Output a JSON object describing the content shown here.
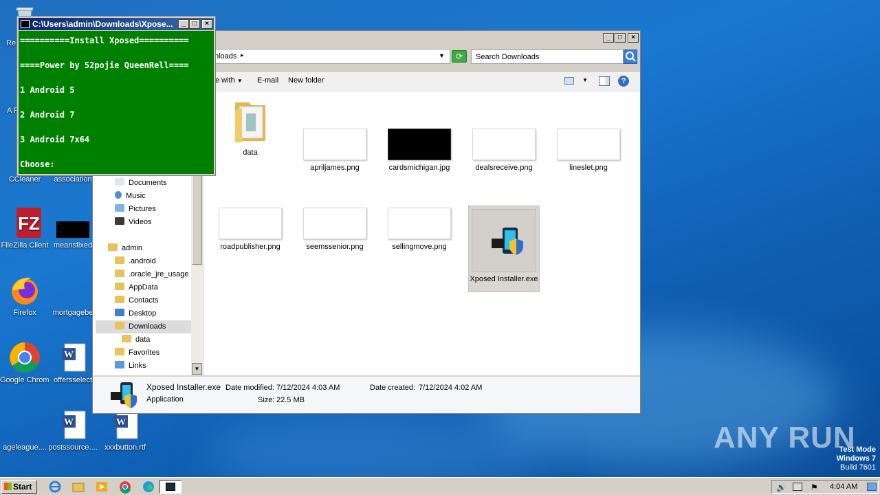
{
  "desktop_icons": [
    {
      "label": "Re",
      "icon": "recycle-bin-icon"
    },
    {
      "label": "A Re",
      "icon": "acrobat-icon"
    },
    {
      "label": "CCleaner",
      "icon": "ccleaner-icon"
    },
    {
      "label": "association",
      "icon": "file-icon"
    },
    {
      "label": "FileZilla Client",
      "icon": "filezilla-icon"
    },
    {
      "label": "meansfixed",
      "icon": "image-file-icon"
    },
    {
      "label": "Firefox",
      "icon": "firefox-icon"
    },
    {
      "label": "mortgagebe",
      "icon": "file-icon"
    },
    {
      "label": "Google Chrome",
      "icon": "chrome-icon"
    },
    {
      "label": "offersselect",
      "icon": "word-doc-icon"
    },
    {
      "label": "ageleague....",
      "icon": "file-icon"
    },
    {
      "label": "postssource....",
      "icon": "word-doc-icon"
    },
    {
      "label": "xxxbutton.rtf",
      "icon": "word-doc-icon"
    }
  ],
  "console": {
    "title": "C:\\Users\\admin\\Downloads\\Xpose...",
    "lines": [
      "==========Install Xposed==========",
      "====Power by 52pojie QueenRell====",
      "1 Android 5",
      "2 Android 7",
      "3 Android 7x64",
      "Choose:"
    ]
  },
  "explorer": {
    "address": "nloads",
    "search_placeholder": "Search Downloads",
    "toolbar": {
      "open_with": "e with",
      "email": "E-mail",
      "new_folder": "New folder"
    },
    "nav": [
      {
        "label": "Documents",
        "icon": "documents-icon"
      },
      {
        "label": "Music",
        "icon": "music-icon"
      },
      {
        "label": "Pictures",
        "icon": "pictures-icon"
      },
      {
        "label": "Videos",
        "icon": "videos-icon"
      },
      {
        "label": "admin",
        "icon": "user-folder-icon"
      },
      {
        "label": ".android",
        "icon": "folder-icon"
      },
      {
        "label": ".oracle_jre_usage",
        "icon": "folder-icon"
      },
      {
        "label": "AppData",
        "icon": "folder-icon"
      },
      {
        "label": "Contacts",
        "icon": "contacts-icon"
      },
      {
        "label": "Desktop",
        "icon": "desktop-folder-icon"
      },
      {
        "label": "Downloads",
        "icon": "downloads-icon"
      },
      {
        "label": "data",
        "icon": "folder-icon"
      },
      {
        "label": "Favorites",
        "icon": "favorites-icon"
      },
      {
        "label": "Links",
        "icon": "links-icon"
      }
    ],
    "files": [
      {
        "label": "data",
        "type": "folder"
      },
      {
        "label": "apriljames.png",
        "type": "white"
      },
      {
        "label": "cardsmichigan.jpg",
        "type": "black"
      },
      {
        "label": "dealsreceive.png",
        "type": "white"
      },
      {
        "label": "lineslet.png",
        "type": "white"
      },
      {
        "label": "roadpublisher.png",
        "type": "white"
      },
      {
        "label": "seemssenior.png",
        "type": "white"
      },
      {
        "label": "sellingmove.png",
        "type": "white"
      },
      {
        "label": "Xposed Installer.exe",
        "type": "exe"
      }
    ],
    "details": {
      "name": "Xposed Installer.exe",
      "type": "Application",
      "modified_label": "Date modified:",
      "modified": "7/12/2024 4:03 AM",
      "created_label": "Date created:",
      "created": "7/12/2024 4:02 AM",
      "size_label": "Size:",
      "size": "22.5 MB"
    }
  },
  "taskbar": {
    "start": "Start",
    "clock": "4:04 AM"
  },
  "watermark": {
    "text": "ANY RUN",
    "test_mode": "Test Mode",
    "os": "Windows 7",
    "build": "Build 7601"
  }
}
